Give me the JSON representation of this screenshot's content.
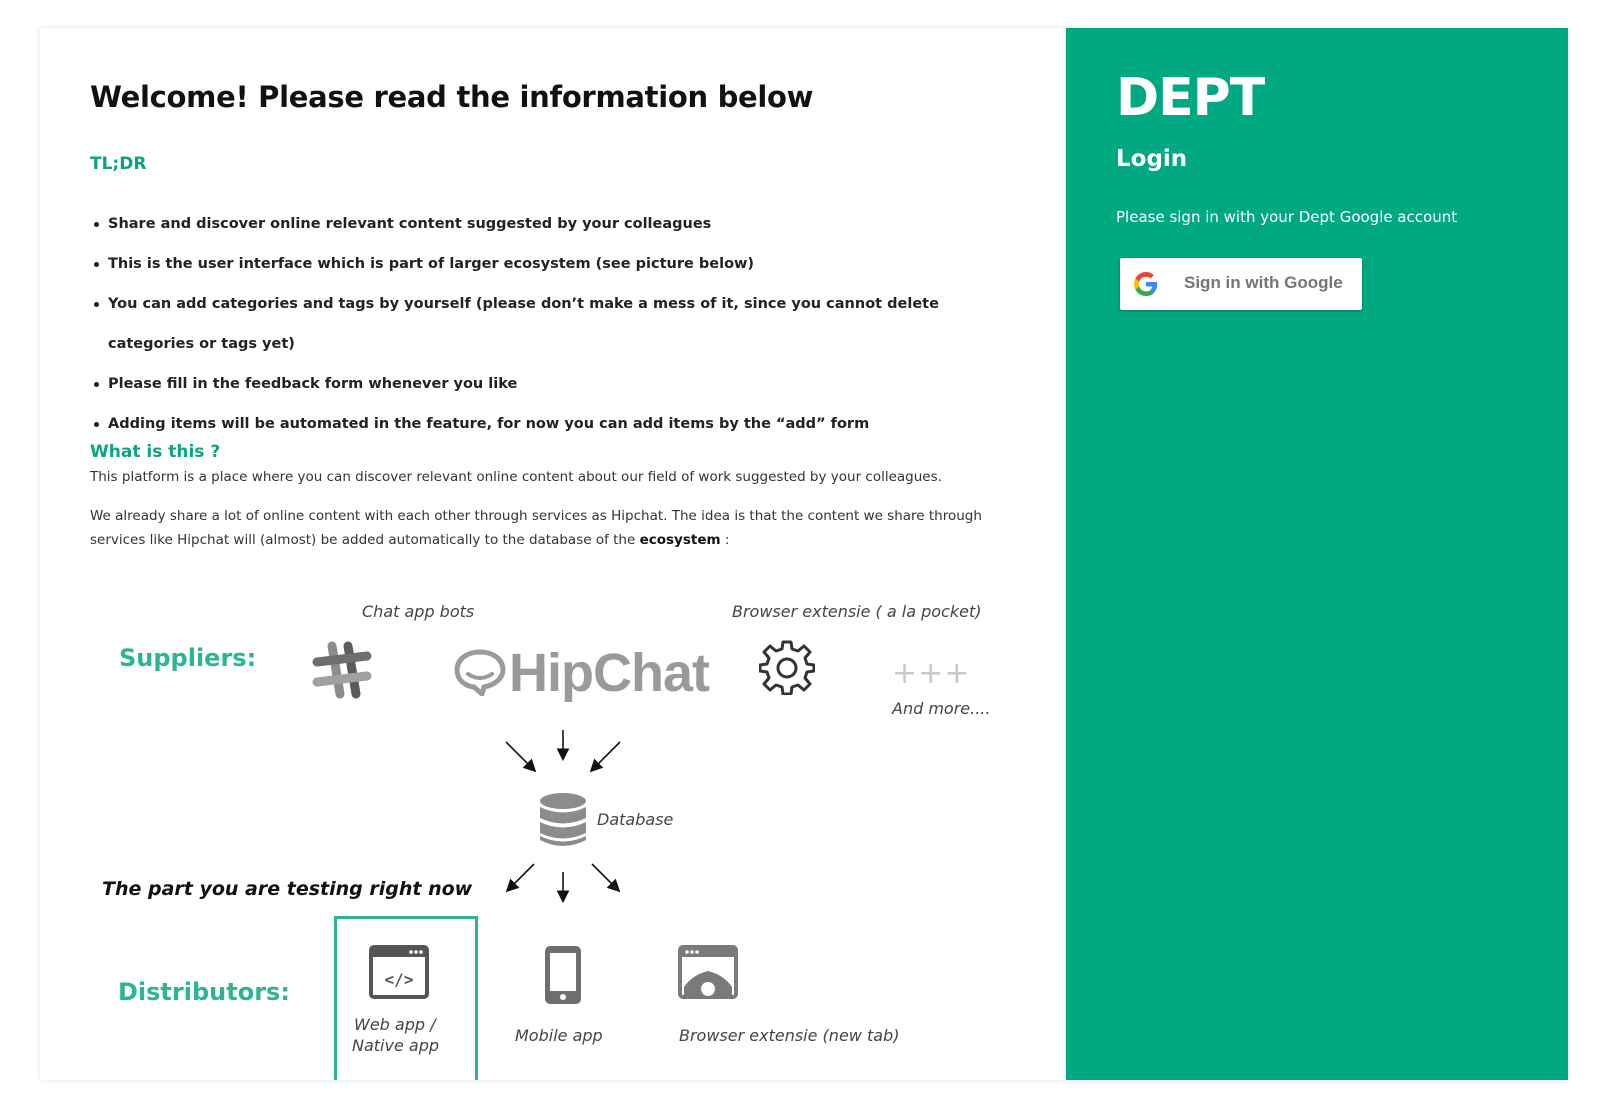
{
  "info": {
    "heading": "Welcome! Please read the information below",
    "tldr_title": "TL;DR",
    "tldr_items": [
      "Share and discover online relevant content suggested by your colleagues",
      "This is the user interface which is part of larger ecosystem (see picture below)",
      "You can add categories and tags by yourself (please don’t make a mess of it, since you cannot delete categories or tags yet)",
      "Please fill in the feedback form whenever you like",
      "Adding items will be automated in the feature, for now you can add items by the “add” form"
    ],
    "what_title": "What is this ?",
    "para1": "This platform is a place where you can discover relevant online content about our field of work suggested by your colleagues.",
    "para2_text": "We already share a lot of online content with each other through services as Hipchat. The idea is that the content we share through services like Hipchat will (almost) be added automatically to the database of the ",
    "para2_bold": "ecosystem",
    "para2_end": " :"
  },
  "diagram": {
    "chat_app_bots": "Chat app bots",
    "browser_extensie_pocket": "Browser extensie ( a la pocket)",
    "suppliers": "Suppliers:",
    "hipchat": "HipChat",
    "plus": "+++",
    "and_more": "And more....",
    "database": "Database",
    "testing_now": "The part you are testing right now",
    "distributors": "Distributors:",
    "web_app_line1": "Web app /",
    "web_app_line2": "Native app",
    "mobile_app": "Mobile app",
    "browser_extensie_tab": "Browser extensie (new tab)",
    "icons": [
      "slack-icon",
      "hipchat-logo-icon",
      "gear-icon",
      "database-icon",
      "web-app-icon",
      "mobile-phone-icon",
      "browser-window-icon"
    ]
  },
  "login": {
    "brand": "DEPT",
    "title": "Login",
    "subtitle": "Please sign in with your Dept Google account",
    "google_button": "Sign in with Google",
    "accent_color": "#00a982"
  }
}
